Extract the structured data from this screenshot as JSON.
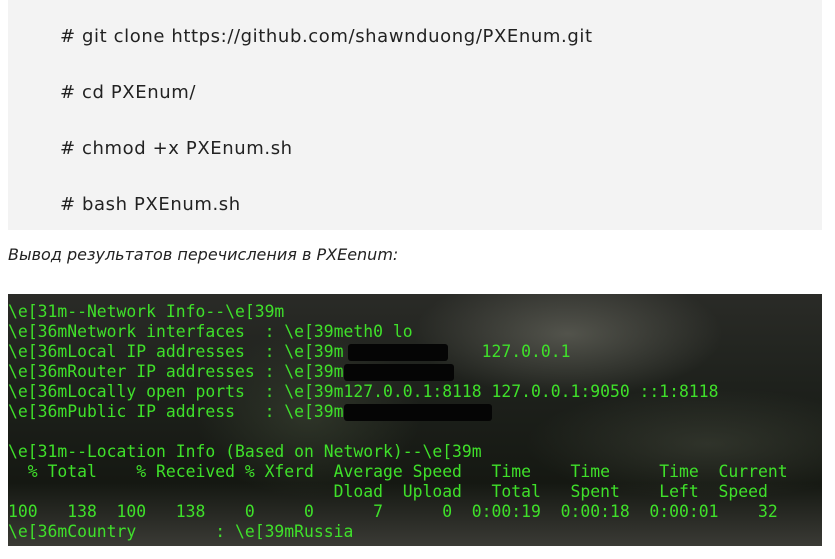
{
  "code_block": {
    "commands": [
      "# git clone https://github.com/shawnduong/PXEnum.git",
      "# cd PXEnum/",
      "# chmod +x PXEnum.sh",
      "# bash PXEnum.sh"
    ]
  },
  "caption": "Вывод результатов перечисления в PXEenum:",
  "terminal": {
    "lines": [
      "\\e[31m--Network Info--\\e[39m",
      "\\e[36mNetwork interfaces  : \\e[39meth0 lo",
      "\\e[36mLocal IP addresses  : \\e[39m              127.0.0.1",
      "\\e[36mRouter IP addresses : \\e[39m",
      "\\e[36mLocally open ports  : \\e[39m127.0.0.1:8118 127.0.0.1:9050 ::1:8118",
      "\\e[36mPublic IP address   : \\e[39m",
      "",
      "\\e[31m--Location Info (Based on Network)--\\e[39m",
      "  % Total    % Received % Xferd  Average Speed   Time    Time     Time  Current",
      "                                 Dload  Upload   Total   Spent    Left  Speed",
      "100   138  100   138    0     0      7      0  0:00:19  0:00:18  0:00:01    32",
      "\\e[36mCountry        : \\e[39mRussia"
    ]
  }
}
